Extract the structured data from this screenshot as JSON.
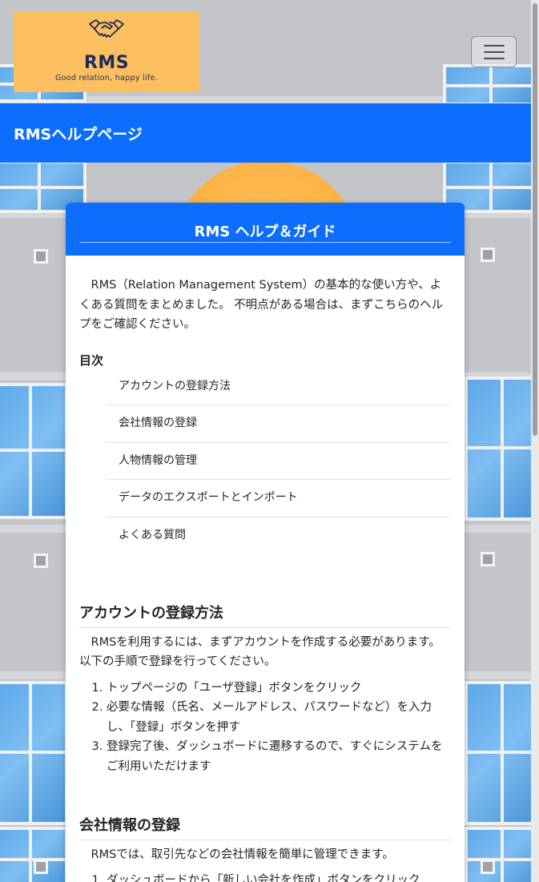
{
  "brand": {
    "logo_icon": "handshake-icon",
    "name": "RMS",
    "tagline": "Good relation, happy life.",
    "colors": {
      "logo_bg": "#fdbf60",
      "logo_text": "#1e2a5a",
      "primary": "#0d6efd"
    }
  },
  "nav": {
    "toggle_icon": "menu-icon"
  },
  "hero": {
    "title": "RMSヘルプページ"
  },
  "card": {
    "title": "RMS ヘルプ＆ガイド",
    "intro": "RMS（Relation Management System）の基本的な使い方や、よくある質問をまとめました。 不明点がある場合は、まずこちらのヘルプをご確認ください。",
    "toc_title": "目次",
    "toc": [
      {
        "label": "アカウントの登録方法"
      },
      {
        "label": "会社情報の登録"
      },
      {
        "label": "人物情報の管理"
      },
      {
        "label": "データのエクスポートとインポート"
      },
      {
        "label": "よくある質問"
      }
    ],
    "sections": [
      {
        "title": "アカウントの登録方法",
        "text": "RMSを利用するには、まずアカウントを作成する必要があります。以下の手順で登録を行ってください。",
        "steps": [
          "トップページの「ユーザ登録」ボタンをクリック",
          "必要な情報（氏名、メールアドレス、パスワードなど）を入力し、「登録」ボタンを押す",
          "登録完了後、ダッシュボードに遷移するので、すぐにシステムをご利用いただけます"
        ]
      },
      {
        "title": "会社情報の登録",
        "text": "RMSでは、取引先などの会社情報を簡単に管理できます。",
        "steps": [
          "ダッシュボードから「新しい会社を作成」ボタンをクリック"
        ]
      }
    ]
  }
}
